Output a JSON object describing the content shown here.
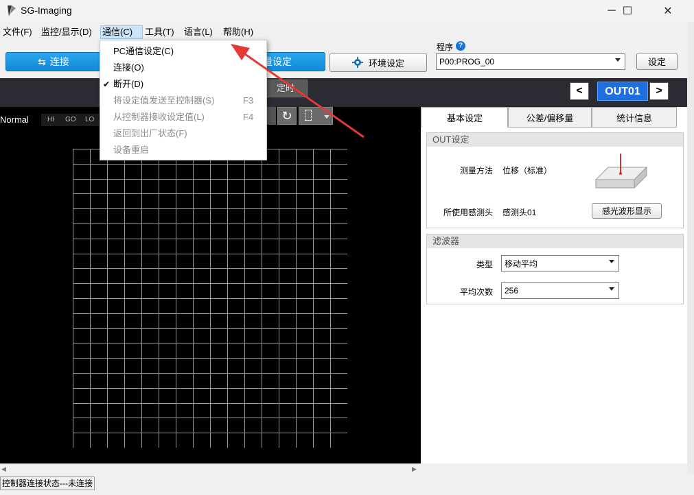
{
  "window": {
    "title": "SG-Imaging",
    "minimize": "─",
    "maximize": "☐",
    "close": "✕"
  },
  "menu": {
    "file": "文件(F)",
    "monitor": "监控/显示(D)",
    "comm": "通信(C)",
    "tools": "工具(T)",
    "language": "语言(L)",
    "help": "帮助(H)"
  },
  "toolbar": {
    "connect": "连接",
    "measure_settings_partial": "量设定",
    "env_settings": "环境设定",
    "program_label": "程序",
    "program_value": "P00:PROG_00",
    "set_button": "设定",
    "fixed_partial": "定时"
  },
  "view": {
    "mode": "Normal",
    "judge": [
      "HI",
      "GO",
      "LO"
    ],
    "out_label": "OUT01",
    "prev": "<",
    "next": ">"
  },
  "tabs": [
    "基本设定",
    "公差/偏移量",
    "统计信息"
  ],
  "out_settings": {
    "title": "OUT设定",
    "method_label": "测量方法",
    "method_value": "位移（标准）",
    "sensor_label": "所使用感测头",
    "sensor_value": "感测头01",
    "waveform_button": "感光波形显示"
  },
  "filter": {
    "title": "滤波器",
    "type_label": "类型",
    "type_value": "移动平均",
    "avg_label": "平均次数",
    "avg_value": "256"
  },
  "comm_menu": {
    "items": [
      {
        "label": "PC通信设定(C)",
        "shortcut": "",
        "enabled": true,
        "checked": false
      },
      {
        "label": "连接(O)",
        "shortcut": "",
        "enabled": true,
        "checked": false
      },
      {
        "label": "断开(D)",
        "shortcut": "",
        "enabled": true,
        "checked": true
      },
      {
        "label": "将设定值发送至控制器(S)",
        "shortcut": "F3",
        "enabled": false,
        "checked": false
      },
      {
        "label": "从控制器接收设定值(L)",
        "shortcut": "F4",
        "enabled": false,
        "checked": false
      },
      {
        "label": "返回到出厂状态(F)",
        "shortcut": "",
        "enabled": false,
        "checked": false
      },
      {
        "label": "设备重启",
        "shortcut": "",
        "enabled": false,
        "checked": false
      }
    ]
  },
  "status": {
    "connection": "控制器连接状态---未连接"
  },
  "colors": {
    "accent_blue": "#1a8fe0",
    "out_badge": "#1f6fe0",
    "arrow_red": "#e53935"
  }
}
